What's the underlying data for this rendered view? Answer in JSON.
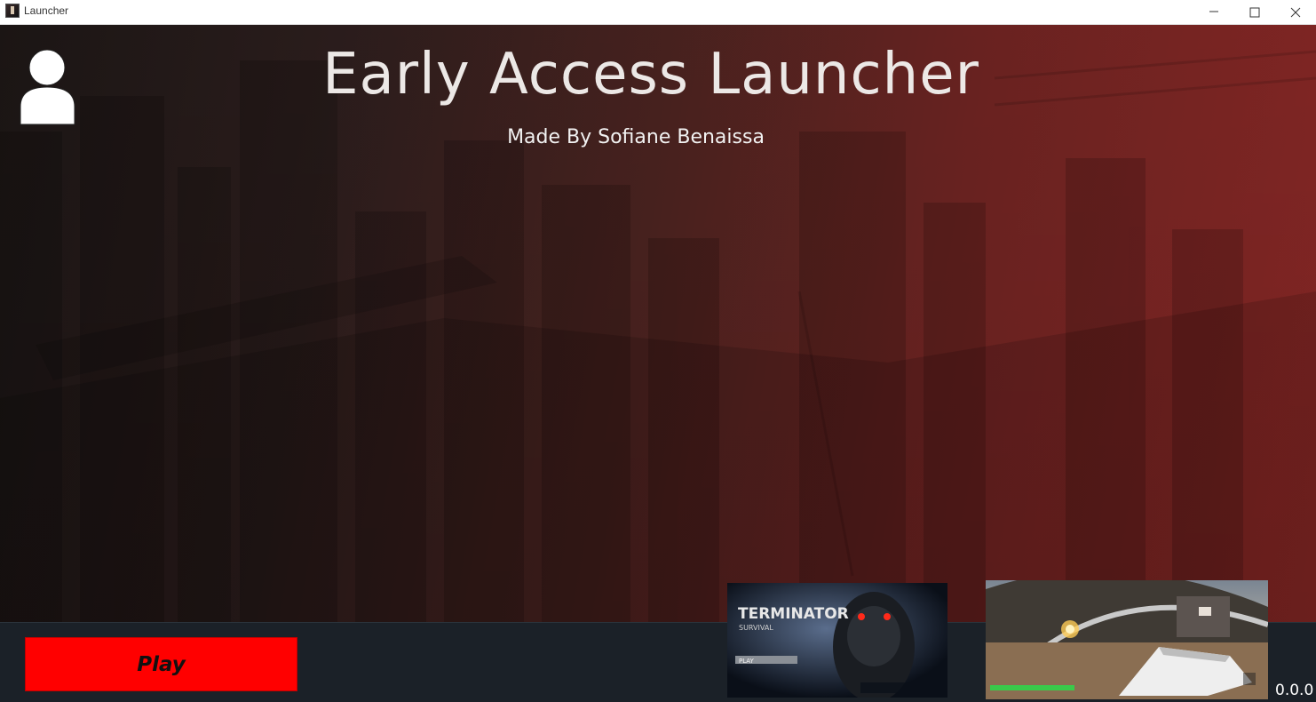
{
  "window": {
    "title": "Launcher",
    "controls": [
      "minimize-icon",
      "maximize-icon",
      "close-icon"
    ]
  },
  "header": {
    "title": "Early Access Launcher",
    "subtitle": "Made By Sofiane Benaissa",
    "profile_icon": "user-icon"
  },
  "footer": {
    "play_label": "Play",
    "version": "0.0.0",
    "thumbnails": [
      {
        "name": "terminator-survival-screenshot",
        "title": "TERMINATOR",
        "subtitle": "SURVIVAL",
        "button": "PLAY"
      },
      {
        "name": "gameplay-screenshot"
      }
    ]
  },
  "colors": {
    "play_button": "#ff0000",
    "bottom_bar": "#1b2128",
    "hero_left": "#1c1615",
    "hero_right": "#8b2826"
  }
}
